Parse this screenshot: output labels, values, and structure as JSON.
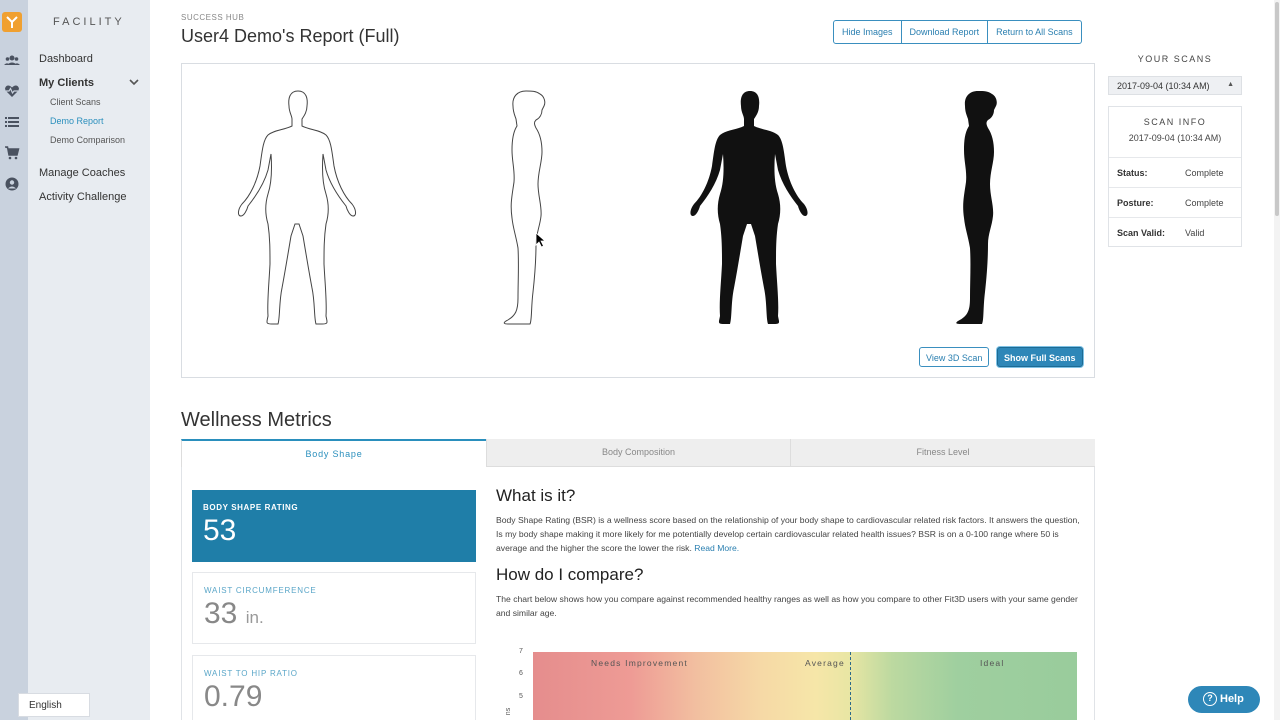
{
  "sidebar": {
    "brand": "FACILITY",
    "nav": {
      "dashboard": "Dashboard",
      "my_clients": "My Clients",
      "client_scans": "Client Scans",
      "demo_report": "Demo Report",
      "demo_comparison": "Demo Comparison",
      "manage_coaches": "Manage Coaches",
      "activity_challenge": "Activity Challenge"
    },
    "language": "English"
  },
  "header": {
    "kicker": "SUCCESS HUB",
    "title": "User4 Demo's Report (Full)",
    "buttons": {
      "hide_images": "Hide Images",
      "download_report": "Download Report",
      "return_all": "Return to All Scans"
    }
  },
  "scan_view": {
    "view_3d": "View 3D Scan",
    "show_full": "Show Full Scans"
  },
  "right": {
    "your_scans": "YOUR SCANS",
    "selected_scan": "2017-09-04 (10:34 AM)",
    "scan_info_title": "SCAN INFO",
    "scan_info_date": "2017-09-04 (10:34 AM)",
    "rows": [
      {
        "k": "Status:",
        "v": "Complete"
      },
      {
        "k": "Posture:",
        "v": "Complete"
      },
      {
        "k": "Scan Valid:",
        "v": "Valid"
      }
    ]
  },
  "wellness": {
    "title": "Wellness Metrics",
    "tabs": [
      "Body Shape",
      "Body Composition",
      "Fitness Level"
    ],
    "cards": {
      "bsr_label": "BODY SHAPE RATING",
      "bsr_value": "53",
      "waist_label": "WAIST CIRCUMFERENCE",
      "waist_value": "33",
      "waist_unit": "in.",
      "whr_label": "WAIST TO HIP RATIO",
      "whr_value": "0.79"
    },
    "what_title": "What is it?",
    "what_text": "Body Shape Rating (BSR) is a wellness score based on the relationship of your body shape to cardiovascular related risk factors. It answers the question, Is my body shape making it more likely for me potentially develop certain cardiovascular related health issues? BSR is on a 0-100 range where 50 is average and the higher the score the lower the risk.",
    "read_more": "Read More.",
    "compare_title": "How do I compare?",
    "compare_text": "The chart below shows how you compare against recommended healthy ranges as well as how you compare to other Fit3D users with your same gender and similar age.",
    "chart": {
      "y_ticks": [
        "7",
        "6",
        "5"
      ],
      "bands": [
        "Needs Improvement",
        "Average",
        "Ideal"
      ],
      "y_label": "ns"
    }
  },
  "help": "Help",
  "colors": {
    "accent": "#2a8fbd",
    "primary_card": "#1f7ea8",
    "sidebar": "#e8ecf1",
    "rail": "#c9d2de",
    "logo": "#f0a030"
  }
}
